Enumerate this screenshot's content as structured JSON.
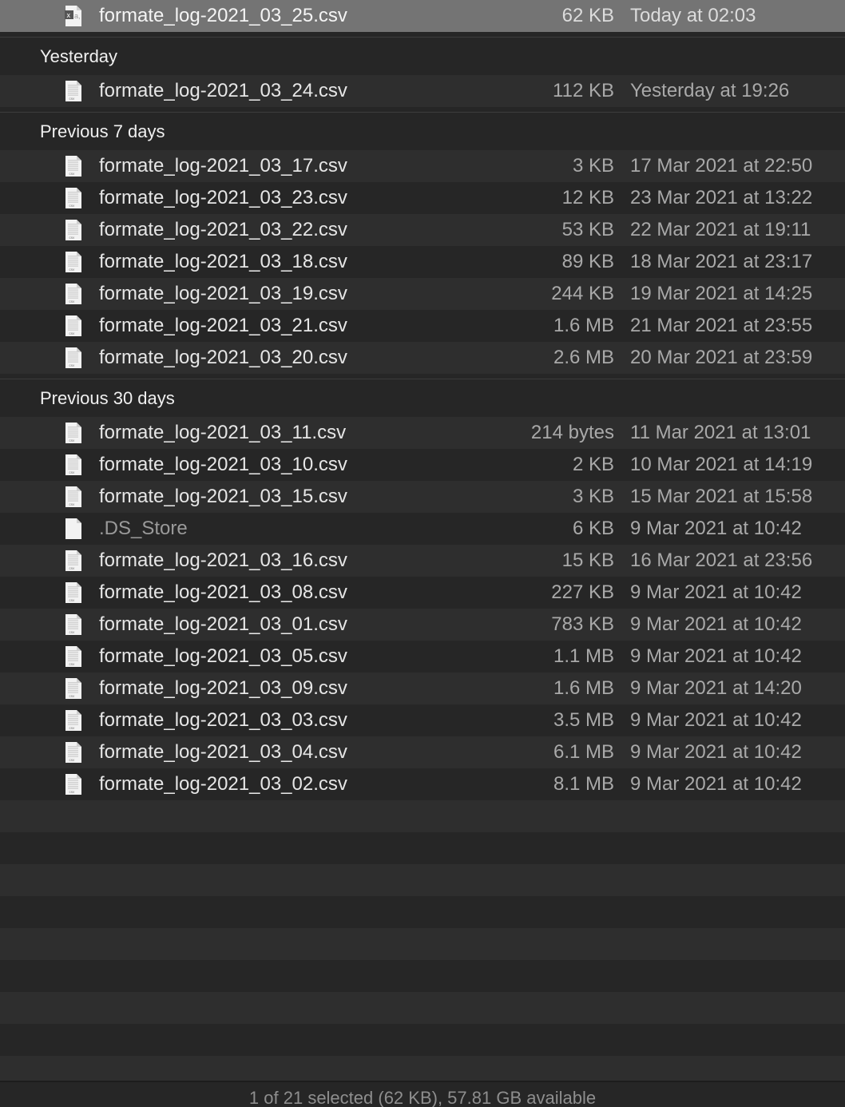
{
  "colors": {
    "selected_row": "#747474",
    "stripe": "#2e2e2e",
    "background": "#262626"
  },
  "selected_file": {
    "name": "formate_log-2021_03_25.csv",
    "size": "62 KB",
    "date": "Today at 02:03",
    "icon": "excel-csv-icon"
  },
  "groups": [
    {
      "title": "Yesterday",
      "files": [
        {
          "name": "formate_log-2021_03_24.csv",
          "size": "112 KB",
          "date": "Yesterday at 19:26",
          "icon": "csv-file-icon"
        }
      ]
    },
    {
      "title": "Previous 7 days",
      "files": [
        {
          "name": "formate_log-2021_03_17.csv",
          "size": "3 KB",
          "date": "17 Mar 2021 at 22:50",
          "icon": "csv-file-icon"
        },
        {
          "name": "formate_log-2021_03_23.csv",
          "size": "12 KB",
          "date": "23 Mar 2021 at 13:22",
          "icon": "csv-file-icon"
        },
        {
          "name": "formate_log-2021_03_22.csv",
          "size": "53 KB",
          "date": "22 Mar 2021 at 19:11",
          "icon": "csv-file-icon"
        },
        {
          "name": "formate_log-2021_03_18.csv",
          "size": "89 KB",
          "date": "18 Mar 2021 at 23:17",
          "icon": "csv-file-icon"
        },
        {
          "name": "formate_log-2021_03_19.csv",
          "size": "244 KB",
          "date": "19 Mar 2021 at 14:25",
          "icon": "csv-file-icon"
        },
        {
          "name": "formate_log-2021_03_21.csv",
          "size": "1.6 MB",
          "date": "21 Mar 2021 at 23:55",
          "icon": "csv-file-icon"
        },
        {
          "name": "formate_log-2021_03_20.csv",
          "size": "2.6 MB",
          "date": "20 Mar 2021 at 23:59",
          "icon": "csv-file-icon"
        }
      ]
    },
    {
      "title": "Previous 30 days",
      "files": [
        {
          "name": "formate_log-2021_03_11.csv",
          "size": "214 bytes",
          "date": "11 Mar 2021 at 13:01",
          "icon": "csv-file-icon"
        },
        {
          "name": "formate_log-2021_03_10.csv",
          "size": "2 KB",
          "date": "10 Mar 2021 at 14:19",
          "icon": "csv-file-icon"
        },
        {
          "name": "formate_log-2021_03_15.csv",
          "size": "3 KB",
          "date": "15 Mar 2021 at 15:58",
          "icon": "csv-file-icon"
        },
        {
          "name": ".DS_Store",
          "size": "6 KB",
          "date": "9 Mar 2021 at 10:42",
          "icon": "blank-file-icon",
          "hidden": true
        },
        {
          "name": "formate_log-2021_03_16.csv",
          "size": "15 KB",
          "date": "16 Mar 2021 at 23:56",
          "icon": "csv-file-icon"
        },
        {
          "name": "formate_log-2021_03_08.csv",
          "size": "227 KB",
          "date": "9 Mar 2021 at 10:42",
          "icon": "csv-file-icon"
        },
        {
          "name": "formate_log-2021_03_01.csv",
          "size": "783 KB",
          "date": "9 Mar 2021 at 10:42",
          "icon": "csv-file-icon"
        },
        {
          "name": "formate_log-2021_03_05.csv",
          "size": "1.1 MB",
          "date": "9 Mar 2021 at 10:42",
          "icon": "csv-file-icon"
        },
        {
          "name": "formate_log-2021_03_09.csv",
          "size": "1.6 MB",
          "date": "9 Mar 2021 at 14:20",
          "icon": "csv-file-icon"
        },
        {
          "name": "formate_log-2021_03_03.csv",
          "size": "3.5 MB",
          "date": "9 Mar 2021 at 10:42",
          "icon": "csv-file-icon"
        },
        {
          "name": "formate_log-2021_03_04.csv",
          "size": "6.1 MB",
          "date": "9 Mar 2021 at 10:42",
          "icon": "csv-file-icon"
        },
        {
          "name": "formate_log-2021_03_02.csv",
          "size": "8.1 MB",
          "date": "9 Mar 2021 at 10:42",
          "icon": "csv-file-icon"
        }
      ]
    }
  ],
  "status_bar": {
    "text": "1 of 21 selected (62 KB), 57.81 GB available"
  }
}
